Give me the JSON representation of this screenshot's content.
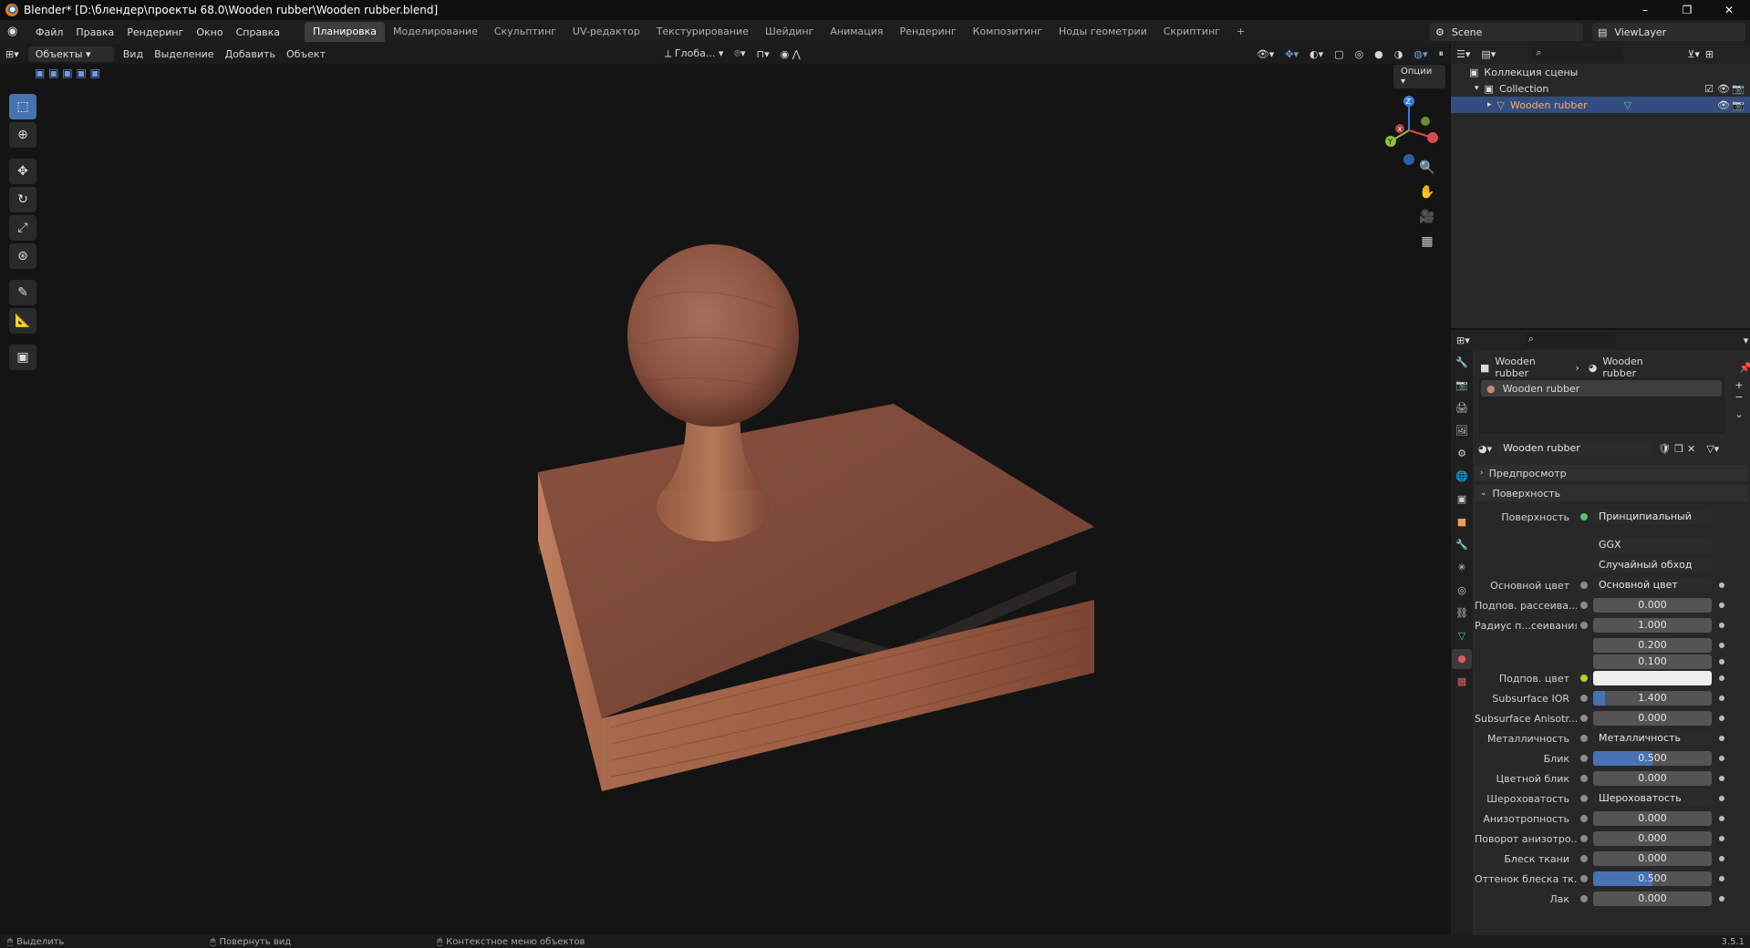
{
  "window": {
    "title": "Blender* [D:\\блендер\\проекты 68.0\\Wooden rubber\\Wooden rubber.blend]",
    "controls": [
      "–",
      "❐",
      "✕"
    ]
  },
  "menu": [
    "Файл",
    "Правка",
    "Рендеринг",
    "Окно",
    "Справка"
  ],
  "workspaces": [
    "Планировка",
    "Моделирование",
    "Скульптинг",
    "UV-редактор",
    "Текстурирование",
    "Шейдинг",
    "Анимация",
    "Рендеринг",
    "Композитинг",
    "Ноды геометрии",
    "Скриптинг",
    "+"
  ],
  "scene": {
    "name": "Scene",
    "view_layer": "ViewLayer"
  },
  "viewport": {
    "mode": "Объекты",
    "menu": [
      "Вид",
      "Выделение",
      "Добавить",
      "Объект"
    ],
    "transform_orientation": "Глоба...",
    "options": "Опции",
    "gizmo": {
      "x": "X",
      "y": "Y",
      "z": "Z"
    }
  },
  "outliner": {
    "root": "Коллекция сцены",
    "collection": "Collection",
    "object": "Wooden rubber"
  },
  "properties": {
    "breadcrumb": [
      "Wooden rubber",
      "Wooden rubber"
    ],
    "slot": "Wooden rubber",
    "material_name": "Wooden rubber",
    "panels": {
      "preview": "Предпросмотр",
      "surface": "Поверхность"
    },
    "surface_label": "Поверхность",
    "surface_value": "Принципиальный BSDF",
    "distribution": "GGX",
    "subsurface_method": "Случайный обход",
    "rows": [
      {
        "label": "Основной цвет",
        "value": "Основной цвет",
        "kind": "link"
      },
      {
        "label": "Подпов. рассеива...",
        "value": "0.000",
        "kind": "num",
        "fill": 0
      },
      {
        "label": "Радиус п...сеивания",
        "value": "1.000",
        "kind": "num",
        "fill": 0
      },
      {
        "label": "",
        "value": "0.200",
        "kind": "num",
        "fill": 0
      },
      {
        "label": "",
        "value": "0.100",
        "kind": "num",
        "fill": 0
      },
      {
        "label": "Подпов. цвет",
        "value": "",
        "kind": "color"
      },
      {
        "label": "Subsurface IOR",
        "value": "1.400",
        "kind": "num",
        "fill": 0.1
      },
      {
        "label": "Subsurface Anisotr...",
        "value": "0.000",
        "kind": "num",
        "fill": 0
      },
      {
        "label": "Металличность",
        "value": "Металличность",
        "kind": "link"
      },
      {
        "label": "Блик",
        "value": "0.500",
        "kind": "num",
        "fill": 0.5
      },
      {
        "label": "Цветной блик",
        "value": "0.000",
        "kind": "num",
        "fill": 0
      },
      {
        "label": "Шероховатость",
        "value": "Шероховатость",
        "kind": "link"
      },
      {
        "label": "Анизотропность",
        "value": "0.000",
        "kind": "num",
        "fill": 0
      },
      {
        "label": "Поворот анизотро...",
        "value": "0.000",
        "kind": "num",
        "fill": 0
      },
      {
        "label": "Блеск ткани",
        "value": "0.000",
        "kind": "num",
        "fill": 0
      },
      {
        "label": "Оттенок блеска тк...",
        "value": "0.500",
        "kind": "num",
        "fill": 0.5
      },
      {
        "label": "Лак",
        "value": "0.000",
        "kind": "num",
        "fill": 0
      }
    ]
  },
  "status": {
    "select": "Выделить",
    "rotate": "Повернуть вид",
    "context": "Контекстное меню объектов",
    "version": "3.5.1"
  },
  "colors": {
    "accent": "#4772b3",
    "selection": "#334d80",
    "wood": "#9a5b43"
  }
}
